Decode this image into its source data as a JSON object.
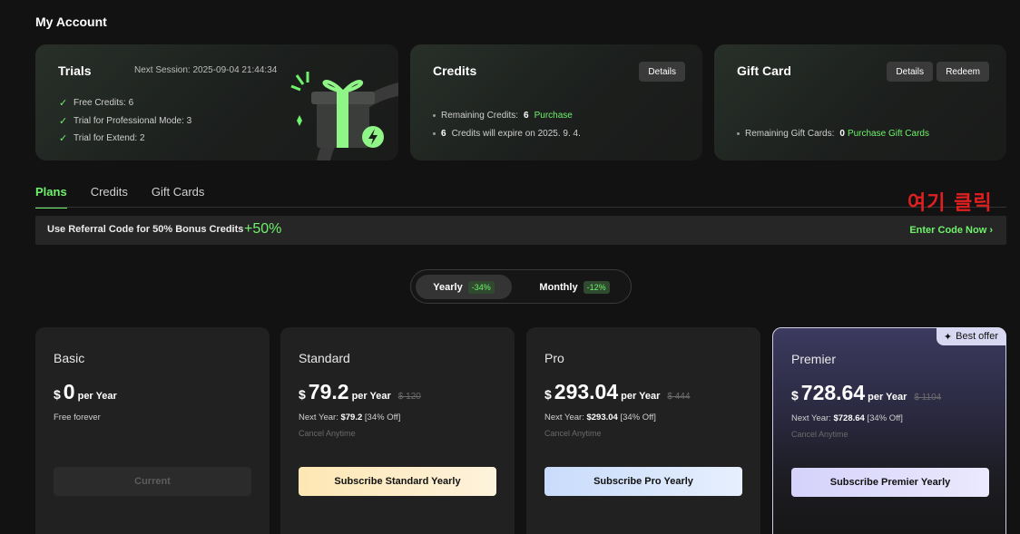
{
  "page_title": "My Account",
  "trials": {
    "title": "Trials",
    "next_session": "Next Session: 2025-09-04 21:44:34",
    "items": [
      "Free Credits: 6",
      "Trial for Professional Mode: 3",
      "Trial for Extend: 2"
    ],
    "icon": "gift-box-icon"
  },
  "credits": {
    "title": "Credits",
    "details_label": "Details",
    "remaining_label": "Remaining Credits:",
    "remaining_value": "6",
    "purchase_label": "Purchase",
    "expire_count": "6",
    "expire_text": "Credits will expire on 2025. 9. 4."
  },
  "gift_card": {
    "title": "Gift Card",
    "details_label": "Details",
    "redeem_label": "Redeem",
    "remaining_label": "Remaining Gift Cards:",
    "remaining_value": "0",
    "purchase_label": "Purchase Gift Cards"
  },
  "tabs": [
    {
      "label": "Plans",
      "active": true
    },
    {
      "label": "Credits",
      "active": false
    },
    {
      "label": "Gift Cards",
      "active": false
    }
  ],
  "annotation": "여기 클릭",
  "referral": {
    "text": "Use Referral Code for 50% Bonus Credits",
    "bonus": "+50%",
    "cta": "Enter Code Now ›"
  },
  "billing_toggle": {
    "yearly_label": "Yearly",
    "yearly_discount": "-34%",
    "monthly_label": "Monthly",
    "monthly_discount": "-12%",
    "selected": "Yearly"
  },
  "plans": [
    {
      "name": "Basic",
      "currency": "$",
      "price": "0",
      "per": "per Year",
      "old_price": "",
      "note": "Free forever",
      "cancel": "",
      "button": "Current"
    },
    {
      "name": "Standard",
      "currency": "$",
      "price": "79.2",
      "per": "per Year",
      "old_price": "$ 120",
      "note_prefix": "Next Year:",
      "note_value": "$79.2",
      "note_suffix": "[34% Off]",
      "cancel": "Cancel Anytime",
      "button": "Subscribe Standard Yearly"
    },
    {
      "name": "Pro",
      "currency": "$",
      "price": "293.04",
      "per": "per Year",
      "old_price": "$ 444",
      "note_prefix": "Next Year:",
      "note_value": "$293.04",
      "note_suffix": "[34% Off]",
      "cancel": "Cancel Anytime",
      "button": "Subscribe Pro Yearly"
    },
    {
      "name": "Premier",
      "currency": "$",
      "price": "728.64",
      "per": "per Year",
      "old_price": "$ 1104",
      "note_prefix": "Next Year:",
      "note_value": "$728.64",
      "note_suffix": "[34% Off]",
      "cancel": "Cancel Anytime",
      "button": "Subscribe Premier Yearly",
      "badge": "Best offer"
    }
  ],
  "colors": {
    "accent_green": "#6ff26b",
    "background": "#121212",
    "annotation_red": "#e02020"
  }
}
